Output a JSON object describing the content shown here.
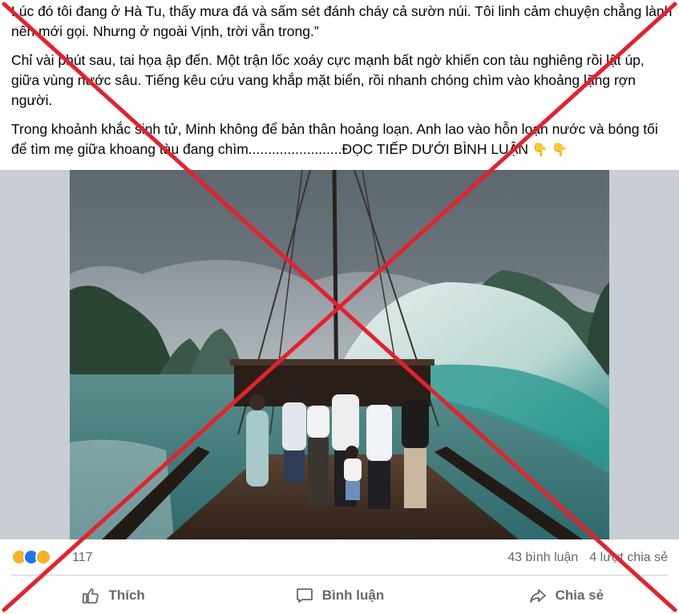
{
  "post": {
    "paragraph1": "Lúc đó tôi đang ở Hà Tu, thấy mưa đá và sấm sét đánh cháy cả sườn núi. Tôi linh cảm chuyện chẳng lành nên mới gọi. Nhưng ở ngoài Vịnh, trời vẫn trong.”",
    "paragraph2": "Chỉ vài phút sau, tai họa ập đến. Một trận lốc xoáy cực mạnh bất ngờ khiến con tàu nghiêng rồi lật úp, giữa vùng nước sâu. Tiếng kêu cứu vang khắp mặt biển, rồi nhanh chóng chìm vào khoảng lặng rợn người.",
    "paragraph3": "Trong khoảnh khắc sinh tử, Minh không để bản thân hoảng loạn. Anh lao vào hỗn loạn nước và bóng tối để tìm mẹ giữa khoang tàu đang chìm........................ĐỌC TIẾP DƯỚI BÌNH LUẬN",
    "pointing_emoji": "👇 👇"
  },
  "reactions": {
    "count": "117",
    "icons": [
      "sad-reaction-icon",
      "like-reaction-icon",
      "care-reaction-icon"
    ]
  },
  "stats": {
    "comments": "43 bình luận",
    "shares": "4 lượt chia sẻ"
  },
  "actions": {
    "like": "Thích",
    "comment": "Bình luận",
    "share": "Chia sẻ"
  },
  "colors": {
    "cross": "#e8202a",
    "action_text": "#65676b",
    "like_blue": "#1877f2"
  }
}
